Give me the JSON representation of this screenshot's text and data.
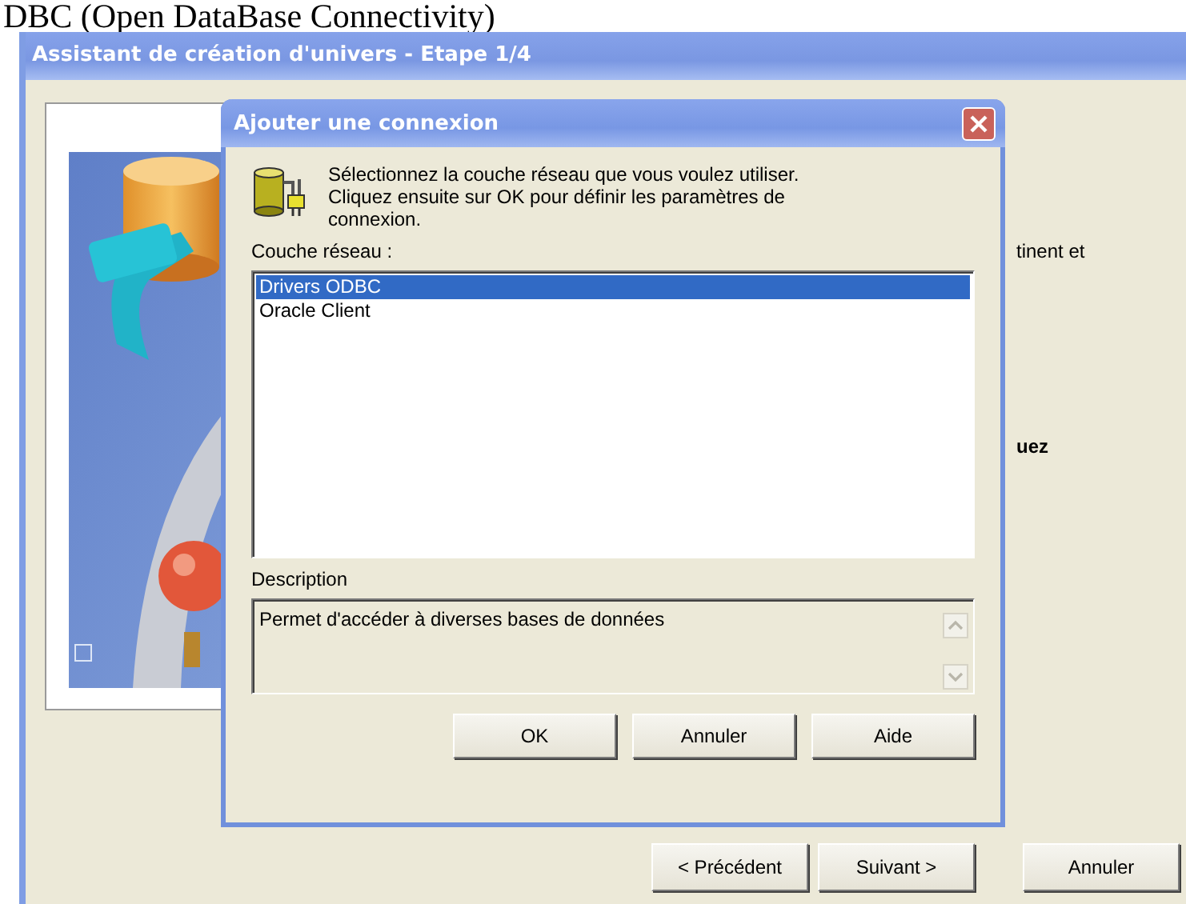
{
  "document_heading": "DBC (Open DataBase Connectivity)",
  "wizard": {
    "title": "Assistant de création d'univers - Etape 1/4",
    "text_fragments": [
      {
        "text": "tinent et",
        "bold": false
      },
      {
        "text": "uez",
        "bold": true
      }
    ],
    "buttons": [
      {
        "label": "< Précédent",
        "kind": "nav"
      },
      {
        "label": "Suivant >",
        "kind": "nav"
      },
      {
        "label": "Annuler",
        "kind": "cancel"
      }
    ]
  },
  "dialog": {
    "title": "Ajouter une connexion",
    "instructions": "Sélectionnez la couche réseau que vous voulez utiliser. Cliquez ensuite sur OK pour définir les paramètres de connexion.",
    "list_label": "Couche réseau :",
    "list_items": [
      {
        "label": "Drivers ODBC",
        "selected": true
      },
      {
        "label": "Oracle Client",
        "selected": false
      }
    ],
    "description_label": "Description",
    "description": "Permet d'accéder à diverses bases de données",
    "buttons": [
      "OK",
      "Annuler",
      "Aide"
    ]
  }
}
